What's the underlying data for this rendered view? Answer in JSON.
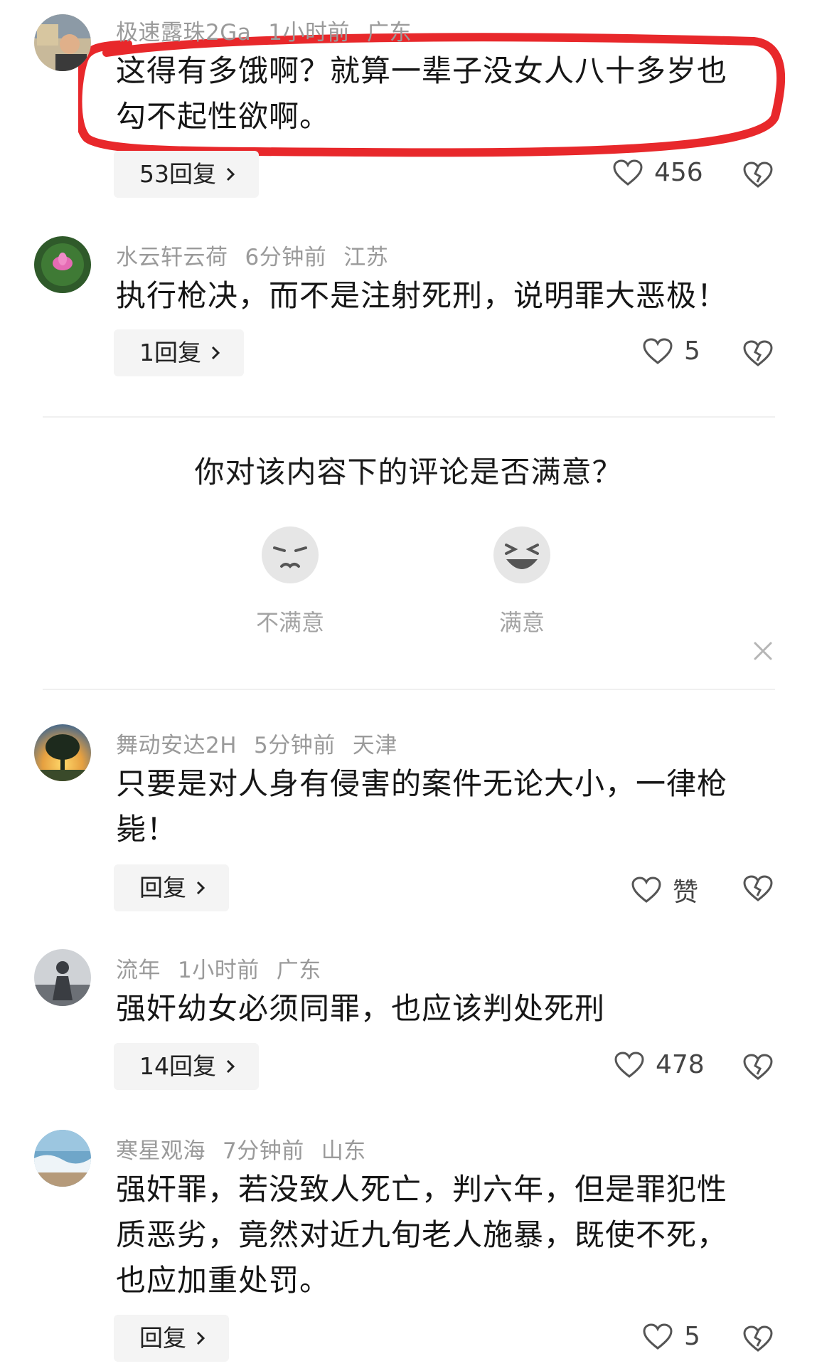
{
  "comments": [
    {
      "user": "极速露珠2Ga",
      "time": "1小时前",
      "location": "广东",
      "text_lines": [
        "这得有多饿啊？就算一辈子没女人八十多岁也",
        "勾不起性欲啊。"
      ],
      "reply_label": "53回复",
      "likes": "456"
    },
    {
      "user": "水云轩云荷",
      "time": "6分钟前",
      "location": "江苏",
      "text_lines": [
        "执行枪决，而不是注射死刑，说明罪大恶极！"
      ],
      "reply_label": "1回复",
      "likes": "5"
    },
    {
      "user": "舞动安达2H",
      "time": "5分钟前",
      "location": "天津",
      "text_lines": [
        "只要是对人身有侵害的案件无论大小，一律枪",
        "毙！"
      ],
      "reply_label": "回复",
      "likes": "赞"
    },
    {
      "user": "流年",
      "time": "1小时前",
      "location": "广东",
      "text_lines": [
        "强奸幼女必须同罪，也应该判处死刑"
      ],
      "reply_label": "14回复",
      "likes": "478"
    },
    {
      "user": "寒星观海",
      "time": "7分钟前",
      "location": "山东",
      "text_lines": [
        "强奸罪，若没致人死亡，判六年，但是罪犯性",
        "质恶劣，竟然对近九旬老人施暴，既使不死，",
        "也应加重处罚。"
      ],
      "reply_label": "回复",
      "likes": "5"
    }
  ],
  "survey": {
    "title": "你对该内容下的评论是否满意？",
    "option_bad": "不满意",
    "option_good": "满意"
  },
  "colors": {
    "highlight_stroke": "#e8282b",
    "meta_text": "#9a9a9a",
    "reply_bg": "#f4f4f4"
  },
  "icons": {
    "like": "heart-outline-icon",
    "dislike": "broken-heart-icon",
    "chevron": "chevron-right-icon",
    "close": "close-icon"
  }
}
